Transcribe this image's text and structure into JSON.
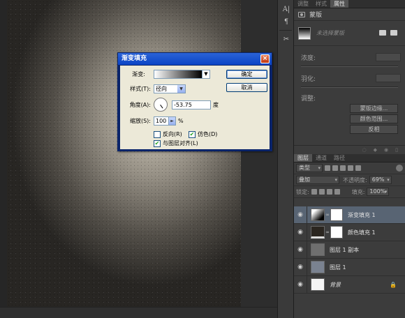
{
  "panel_tabs": [
    "调整",
    "样式",
    "属性"
  ],
  "properties": {
    "header": "蒙版",
    "no_mask": "未选择蒙版",
    "density_label": "浓度:",
    "feather_label": "羽化:",
    "adjust_label": "调整:",
    "buttons": [
      "蒙版边缘...",
      "颜色范围...",
      "反相"
    ]
  },
  "layers_panel": {
    "tabs": [
      "图层",
      "通道",
      "路径"
    ],
    "filter_label": "类型",
    "blend_mode": "叠加",
    "opacity_label": "不透明度:",
    "opacity_value": "69%",
    "lock_label": "锁定:",
    "fill_label": "填充:",
    "fill_value": "100%",
    "layers": [
      {
        "name": "渐变填充 1",
        "selected": true,
        "has_mask": true,
        "thumb": "gradient"
      },
      {
        "name": "颜色填充 1",
        "selected": false,
        "has_mask": true,
        "thumb": "color"
      },
      {
        "name": "图层 1 副本",
        "selected": false,
        "has_mask": false,
        "thumb": "gray"
      },
      {
        "name": "图层 1",
        "selected": false,
        "has_mask": false,
        "thumb": "blue"
      },
      {
        "name": "背景",
        "selected": false,
        "has_mask": false,
        "thumb": "white",
        "italic": true,
        "locked": true
      }
    ]
  },
  "dialog": {
    "title": "渐变填充",
    "gradient_label": "渐变:",
    "style_label": "样式(T):",
    "style_value": "径向",
    "angle_label": "角度(A):",
    "angle_value": "-53.75",
    "angle_unit": "度",
    "scale_label": "缩放(S):",
    "scale_value": "100",
    "scale_unit": "%",
    "reverse_label": "反向(R)",
    "dither_label": "仿色(D)",
    "align_label": "与图层对齐(L)",
    "reverse_checked": false,
    "dither_checked": true,
    "align_checked": true,
    "ok_label": "确定",
    "cancel_label": "取消",
    "close_glyph": "×"
  }
}
